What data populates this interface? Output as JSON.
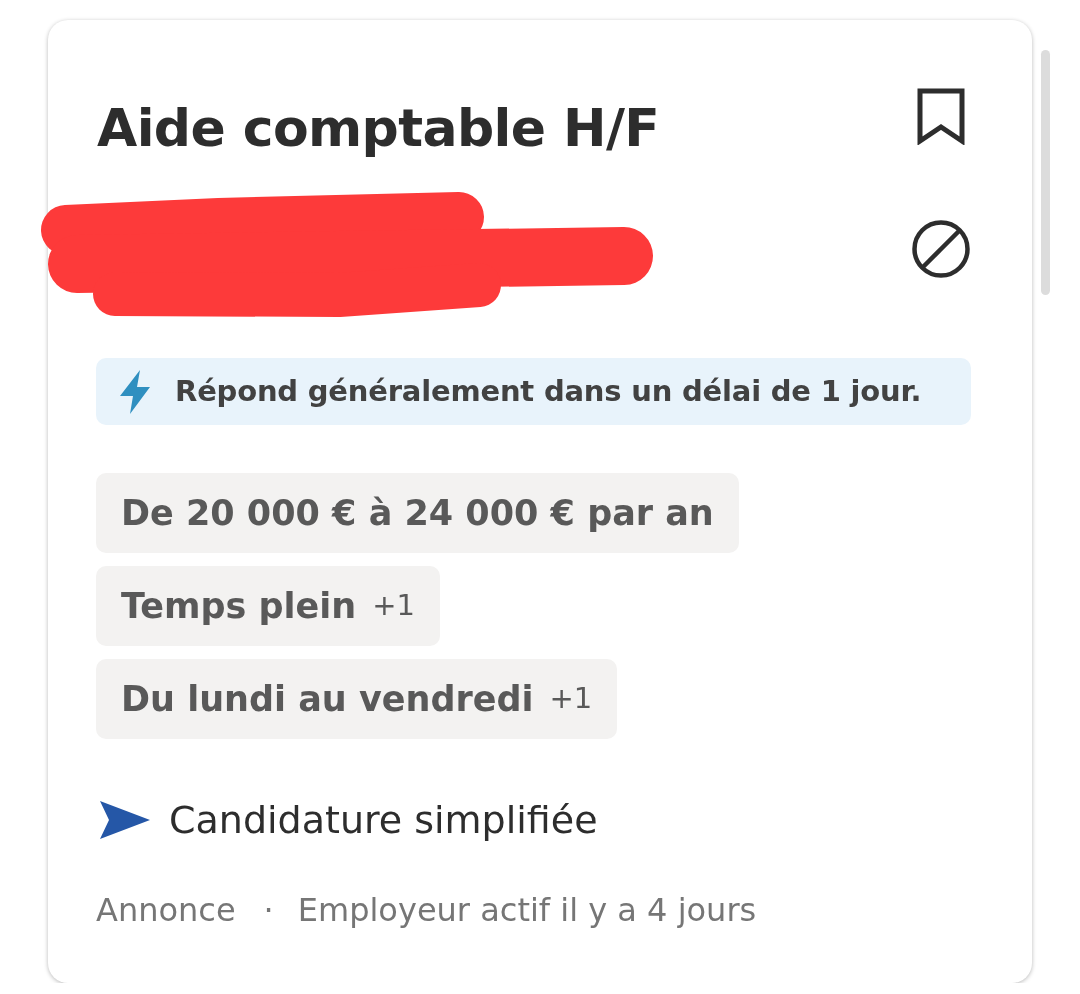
{
  "job": {
    "title": "Aide comptable H/F",
    "saved": false,
    "company_redacted": true
  },
  "response_banner": {
    "text": "Répond généralement dans un délai de 1 jour."
  },
  "tags": [
    {
      "label": "De 20 000 € à 24 000 € par an"
    },
    {
      "label": "Temps plein",
      "more": "+1"
    },
    {
      "label": "Du lundi au vendredi",
      "more": "+1"
    }
  ],
  "easy_apply": {
    "text": "Candidature simplifiée"
  },
  "footer": {
    "source": "Annonce",
    "separator": "·",
    "activity": "Employeur actif il y a 4 jours"
  }
}
